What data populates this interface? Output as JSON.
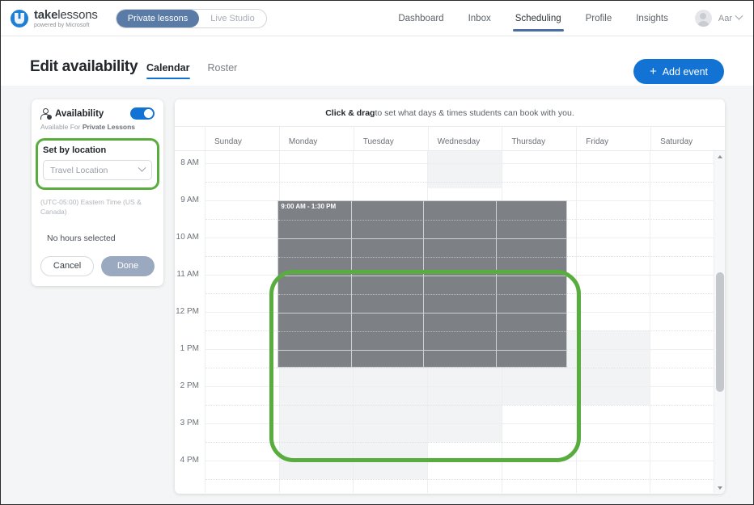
{
  "topbar": {
    "logo": {
      "bold": "take",
      "light": "lessons",
      "subtitle": "powered by Microsoft",
      "icon": "takelessons-logo-icon"
    },
    "segmented": {
      "active": "Private lessons",
      "inactive": "Live Studio"
    },
    "nav": [
      {
        "label": "Dashboard",
        "active": false
      },
      {
        "label": "Inbox",
        "active": false
      },
      {
        "label": "Scheduling",
        "active": true
      },
      {
        "label": "Profile",
        "active": false
      },
      {
        "label": "Insights",
        "active": false
      }
    ],
    "user": {
      "name": "Aar",
      "avatar_icon": "user-avatar-icon",
      "chevron_icon": "chevron-down-icon"
    }
  },
  "page": {
    "title": "Edit availability",
    "subtabs": [
      {
        "label": "Calendar",
        "active": true
      },
      {
        "label": "Roster",
        "active": false
      }
    ],
    "add_event": {
      "label": "Add event",
      "plus": "+",
      "color": "#1273d4"
    }
  },
  "sidebar": {
    "availability_title": "Availability",
    "availability_icon": "person-availability-icon",
    "toggle": {
      "name": "availability-toggle",
      "state": "on",
      "color": "#1273d4"
    },
    "available_for_prefix": "Available For ",
    "available_for_value": "Private Lessons",
    "set_by_location_label": "Set by location",
    "location_value": "Travel Location",
    "location_chevron_icon": "chevron-down-icon",
    "timezone": "(UTC-05:00) Eastern Time (US & Canada)",
    "no_hours": "No hours selected",
    "cancel_label": "Cancel",
    "done_label": "Done",
    "highlight_color": "#59ad3f"
  },
  "calendar": {
    "banner_bold": "Click & drag",
    "banner_rest": " to set what days & times students can book with you.",
    "days": [
      "Sunday",
      "Monday",
      "Tuesday",
      "Wednesday",
      "Thursday",
      "Friday",
      "Saturday"
    ],
    "times": [
      "8 AM",
      "9 AM",
      "10 AM",
      "11 AM",
      "12 PM",
      "1 PM",
      "2 PM",
      "3 PM",
      "4 PM"
    ],
    "selection": {
      "label": "9:00 AM - 1:30 PM",
      "start_time": "9:00 AM",
      "end_time": "1:30 PM",
      "days": [
        "Monday",
        "Tuesday",
        "Wednesday",
        "Thursday"
      ],
      "color": "#7d8084"
    },
    "scrollbar": {
      "up_icon": "scroll-up-arrow-icon",
      "down_icon": "scroll-down-arrow-icon"
    },
    "annotation_color": "#59ad3f"
  }
}
